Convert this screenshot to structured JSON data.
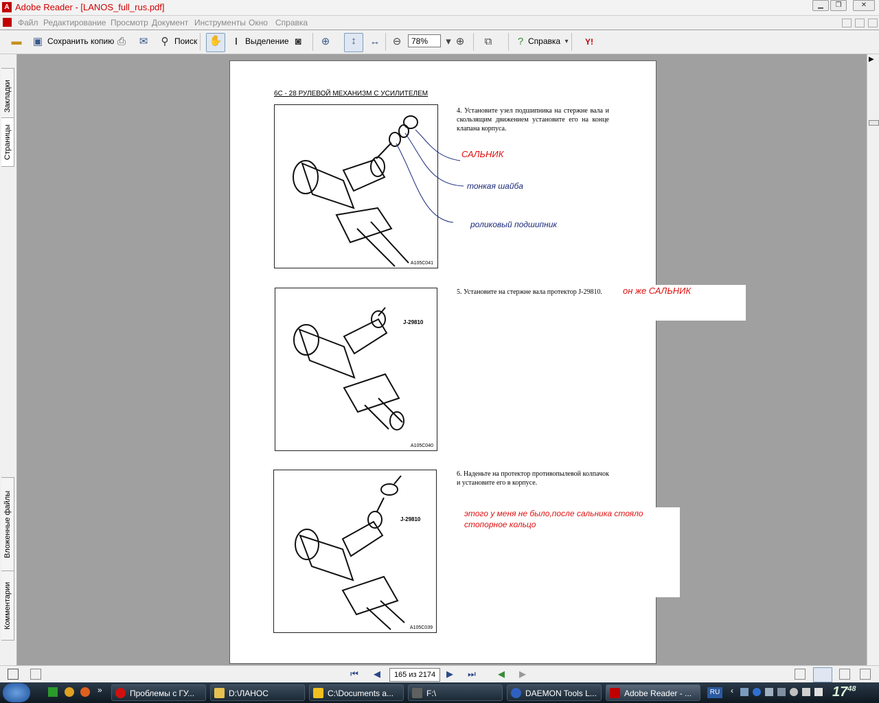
{
  "window": {
    "title": "Adobe Reader - [LANOS_full_rus.pdf]",
    "app_icon": "adobe-reader-icon",
    "controls": [
      "minimize",
      "restore",
      "close"
    ]
  },
  "menu": [
    "Файл",
    "Редактирование",
    "Просмотр",
    "Документ",
    "Инструменты",
    "Окно",
    "Справка"
  ],
  "toolbar": {
    "save_copy": "Сохранить копию",
    "search": "Поиск",
    "select": "Выделение",
    "zoom": "78%",
    "help": "Справка"
  },
  "sidepanel": {
    "bookmarks": "Закладки",
    "pages": "Страницы",
    "attachments": "Вложенные файлы",
    "comments": "Комментарии"
  },
  "page": {
    "header": "6С - 28   РУЛЕВОЙ МЕХАНИЗМ С УСИЛИТЕЛЕМ",
    "figures": [
      {
        "code": "A105C041",
        "label": ""
      },
      {
        "code": "A105C040",
        "label": "J-29810"
      },
      {
        "code": "A105C039",
        "label": "J-29810"
      }
    ],
    "steps": [
      "4.  Установите узел подшипника на стержне вала и скользящим движением установите его на  конце клапана корпуса.",
      "5.  Установите на стержне вала протектор J-29810.",
      "6.  Наденьте на протектор  противопылевой колпачок и установите его в корпусе."
    ],
    "annotations": {
      "oil_seal": "САЛЬНИК",
      "thin_washer": "тонкая шайба",
      "roller_bearing": "роликовый подшипник",
      "same_seal": "он же САЛЬНИК",
      "note": "этого у меня не было,после сальника стояло стопорное кольцо"
    }
  },
  "statusbar": {
    "page_indicator": "165 из 2174"
  },
  "taskbar": {
    "tasks": [
      "Проблемы с ГУ...",
      "D:\\ЛАНОС",
      "C:\\Documents a...",
      "F:\\",
      "DAEMON Tools L...",
      "Adobe Reader - ..."
    ],
    "language": "RU",
    "clock_hour": "17",
    "clock_min": "48"
  },
  "colors": {
    "annotation_red": "#e01010",
    "annotation_blue": "#1a2a7a",
    "title_red": "#d00000"
  }
}
